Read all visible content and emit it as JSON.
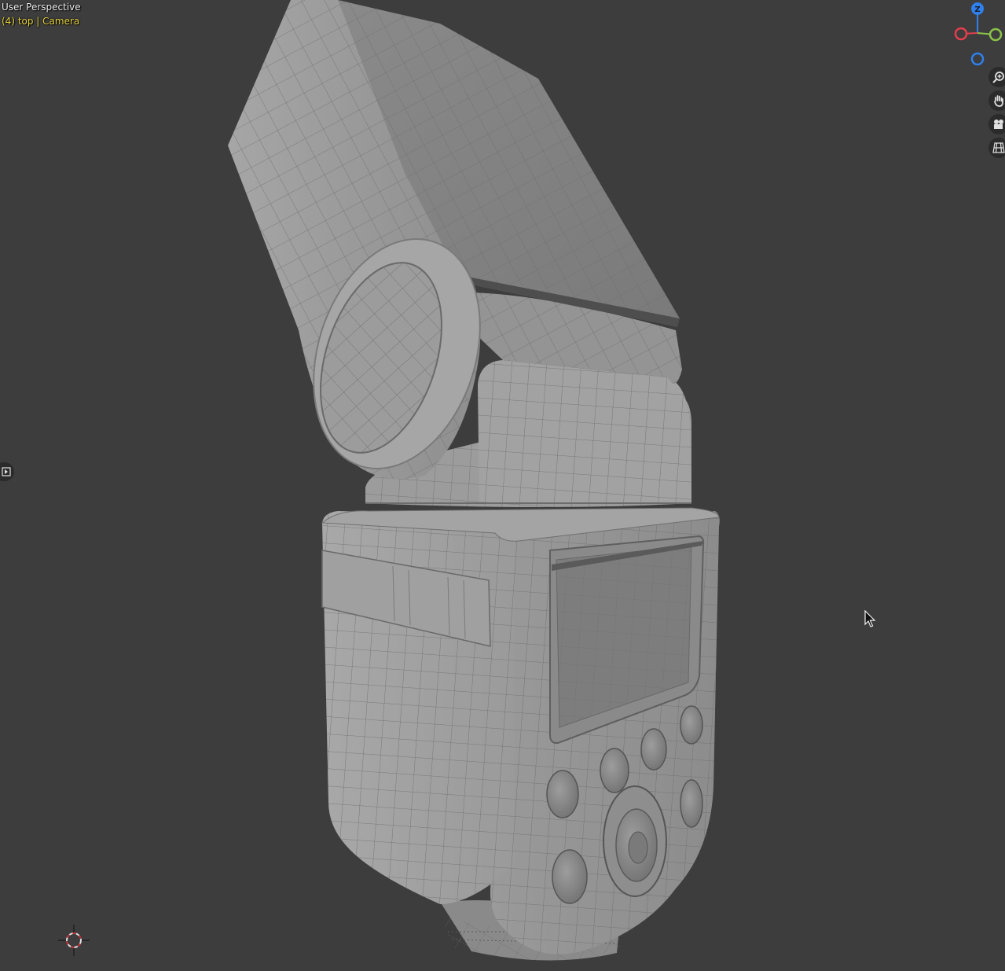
{
  "viewport": {
    "view_name": "User Perspective",
    "view_info": "(4) top | Camera",
    "background_color": "#3d3d3d"
  },
  "gizmo": {
    "z_axis_label": "Z",
    "x_axis_color": "#e53e4d",
    "y_axis_color": "#8bc34a",
    "z_axis_color": "#2f80ed"
  },
  "nav_buttons": [
    {
      "name": "zoom",
      "icon": "magnifier-plus-icon"
    },
    {
      "name": "pan",
      "icon": "hand-icon"
    },
    {
      "name": "camera",
      "icon": "camera-icon"
    },
    {
      "name": "ortho",
      "icon": "grid-icon"
    }
  ],
  "scene_object": {
    "description_icon": "flash-unit-mesh"
  }
}
